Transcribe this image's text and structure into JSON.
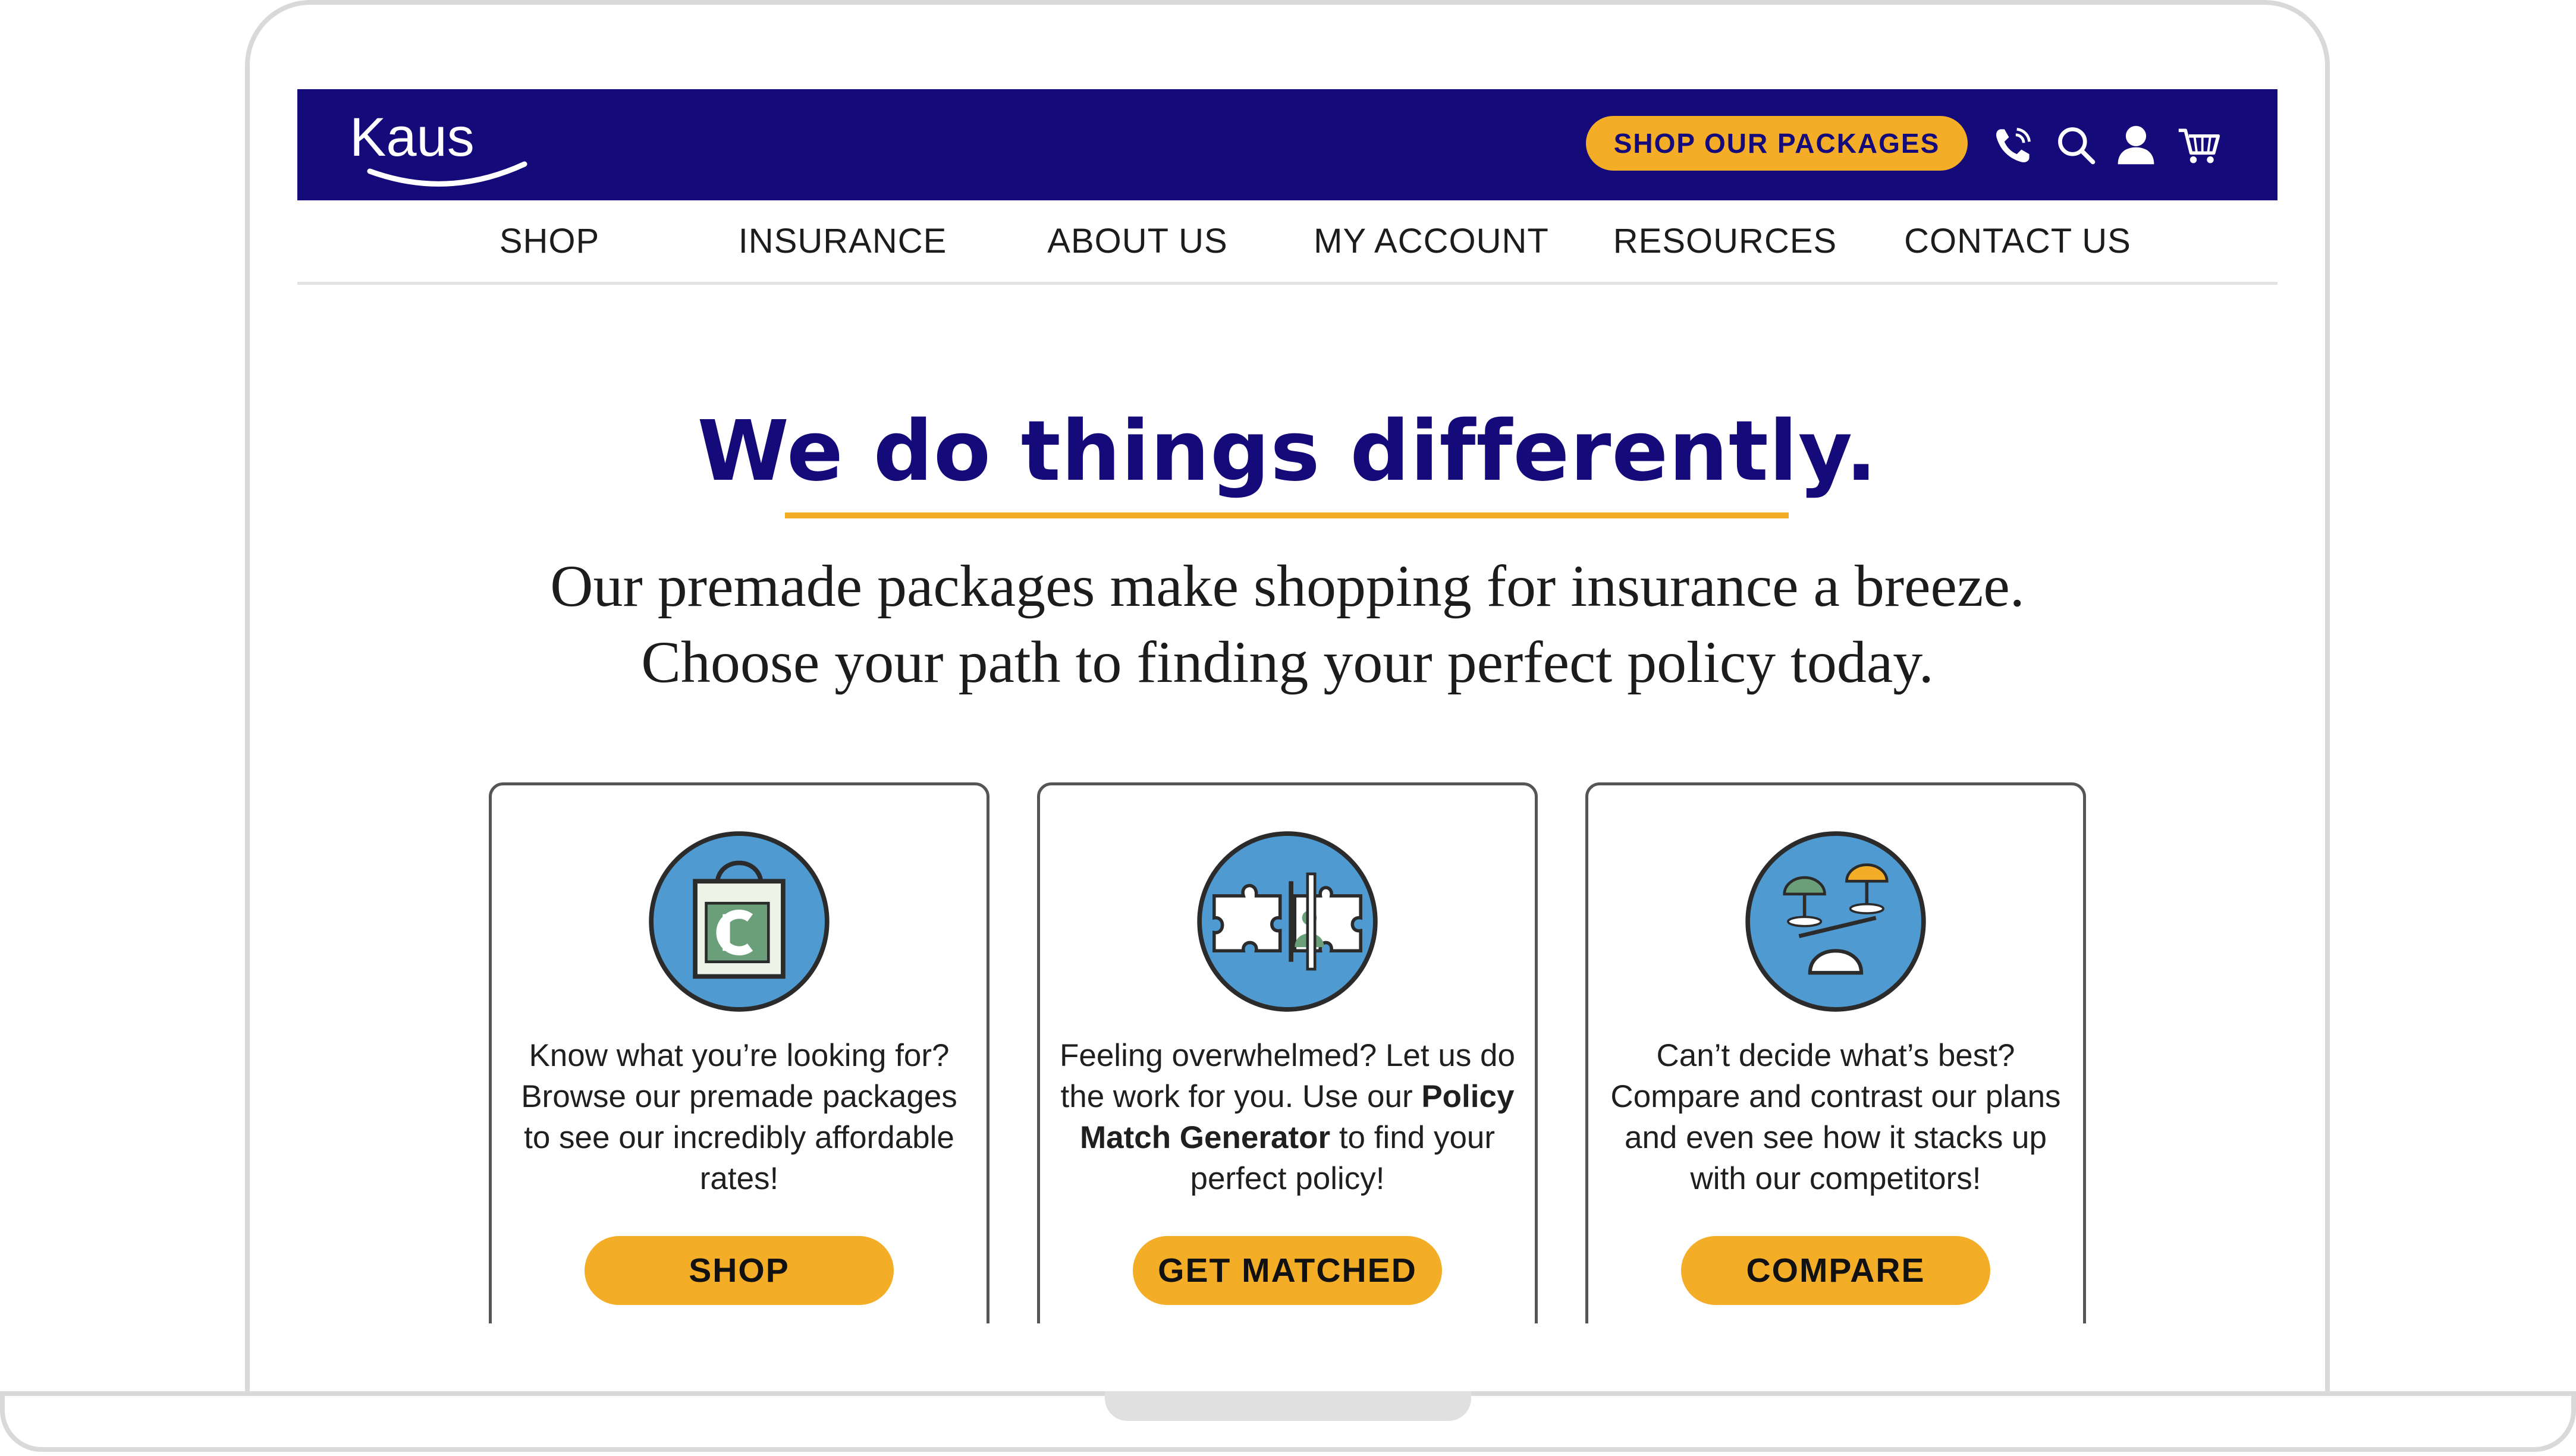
{
  "header": {
    "logo_text": "Kaus",
    "packages_button": "SHOP OUR PACKAGES",
    "icons": [
      "phone-icon",
      "search-icon",
      "user-icon",
      "cart-icon"
    ]
  },
  "nav": {
    "items": [
      {
        "label": "SHOP"
      },
      {
        "label": "INSURANCE"
      },
      {
        "label": "ABOUT US"
      },
      {
        "label": "MY ACCOUNT"
      },
      {
        "label": "RESOURCES"
      },
      {
        "label": "CONTACT US"
      }
    ]
  },
  "hero": {
    "headline": "We do things differently.",
    "subline_1": "Our premade packages make shopping for insurance a breeze.",
    "subline_2": "Choose your path to finding your perfect policy today."
  },
  "cards": [
    {
      "icon": "shopping-bag-icon",
      "text": "Know what you’re looking for? Browse our premade packages to see our incredibly affordable rates!",
      "button": "SHOP"
    },
    {
      "icon": "puzzle-icon",
      "text_before": "Feeling overwhelmed? Let us do the work for you. Use our ",
      "text_bold": "Policy Match Generator",
      "text_after": " to find your perfect policy!",
      "button": "GET MATCHED"
    },
    {
      "icon": "scale-umbrella-icon",
      "text": "Can’t decide what’s best? Compare and contrast our plans and even see how it stacks up with our competitors!",
      "button": "COMPARE"
    }
  ],
  "colors": {
    "brand_navy": "#150a7a",
    "accent_yellow": "#f4ad27",
    "icon_blue": "#4f9bd1",
    "frame_gray": "#d9d9d9"
  }
}
